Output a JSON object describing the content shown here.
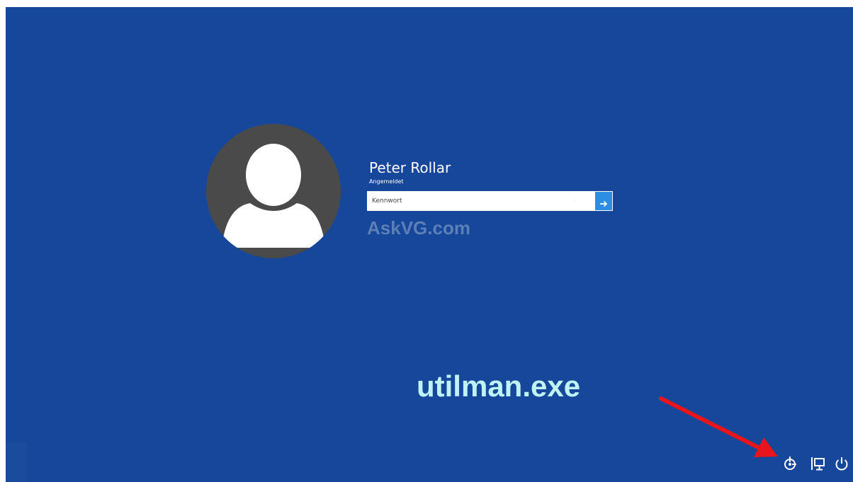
{
  "user": {
    "name": "Peter Rollar",
    "status": "Angemeldet"
  },
  "password": {
    "placeholder": "Kennwort",
    "value": ""
  },
  "watermark": "AskVG.com",
  "annotation": {
    "text": "utilman.exe",
    "arrow_color": "#e8161c"
  },
  "colors": {
    "background": "#16479a",
    "submit_button": "#2d8de3",
    "annotation_text": "#bff3f7"
  },
  "icons": {
    "submit": "arrow-right-icon",
    "reveal": "eye-icon",
    "ease_of_access": "ease-of-access-icon",
    "network": "network-icon",
    "power": "power-icon"
  }
}
